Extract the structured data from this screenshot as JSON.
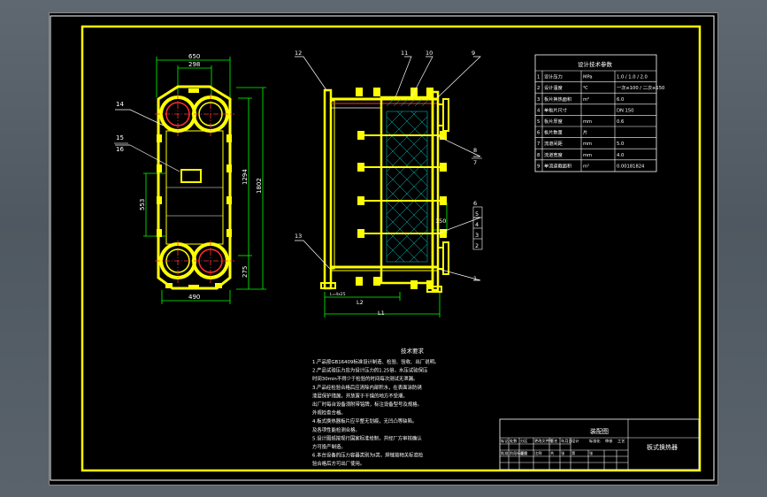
{
  "colors": {
    "background": "#000000",
    "frame": "#ffff00",
    "lines": "#ffffff",
    "dimension": "#00ff00",
    "center_line": "#ff3030",
    "leader": "#ffffff",
    "hatch": "#00d0d0",
    "app_backdrop": "#56606a"
  },
  "front_view": {
    "dim_top_outer": "650",
    "dim_top_inner": "298",
    "dim_height": "1802",
    "dim_port_center": "1294",
    "dim_middle": "553",
    "dim_bottom_offset": "275",
    "dim_bottom_width": "490",
    "label_14": "14",
    "label_15": "15",
    "label_16": "16"
  },
  "side_view": {
    "label_12": "12",
    "label_11": "11",
    "label_10": "10",
    "label_9": "9",
    "label_8": "8",
    "label_7": "7",
    "label_6": "6",
    "label_5": "5",
    "label_4": "4",
    "label_3": "3",
    "label_2": "2",
    "label_1": "1",
    "label_13": "13",
    "dim_150": "150",
    "dim_L2": "L2",
    "dim_L1": "L1",
    "small_note": "L=4x25"
  },
  "tech_table": {
    "title": "设计技术参数",
    "rows": [
      {
        "no": "1",
        "name": "设计压力",
        "unit": "MPa",
        "value": "1.0 / 1.0 / 2.0"
      },
      {
        "no": "2",
        "name": "设计温度",
        "unit": "℃",
        "value": "一次≤100 / 二次≤150"
      },
      {
        "no": "3",
        "name": "板片换热面积",
        "unit": "m²",
        "value": "6.0"
      },
      {
        "no": "4",
        "name": "单板片尺寸",
        "unit": "",
        "value": "DN 150"
      },
      {
        "no": "5",
        "name": "板片厚度",
        "unit": "mm",
        "value": "0.6"
      },
      {
        "no": "6",
        "name": "板片数量",
        "unit": "片",
        "value": ""
      },
      {
        "no": "7",
        "name": "流道间距",
        "unit": "mm",
        "value": "5.0"
      },
      {
        "no": "8",
        "name": "流道宽度",
        "unit": "mm",
        "value": "4.0"
      },
      {
        "no": "9",
        "name": "单流道截面积",
        "unit": "m²",
        "value": "0.00181824"
      }
    ]
  },
  "tech_requirements": {
    "title": "技术要求",
    "lines": [
      "1.产品按GB16409标准设计制造、检验、验收、出厂说明。",
      "2.产品试验压力应为设计压力的1.25倍，水压试验保压",
      "  时间30min不得少于检验的时间每次测试无泄漏。",
      "3.产品经检验合格后应清除内部积水，在表面涂防锈",
      "  漆层保护措施，并放置于干燥的地方不受潮。",
      "  出厂时每台设备须附带铭牌，标注设备型号及规格。",
      "  外观检查合格。",
      "4.板式换热器板片应平整无划痕，无凹凸等缺陷。",
      "  及各项性能检测合格。",
      "5.设计图纸按现行国家标准绘制，并经厂方审核确认",
      "  方可投产制造。",
      "6.本台设备的压力容器类别为I类，焊缝按相关标准检",
      "  验合格后方可出厂使用。"
    ]
  },
  "title_block": {
    "drawing_title": "板式换热器",
    "scale_label": "装配图",
    "cells": [
      "标记",
      "处数",
      "分区",
      "更改文件号",
      "签名",
      "年月日",
      "设计",
      "标准化",
      "审核",
      "工艺",
      "批准",
      "阶段标记",
      "重量",
      "比例",
      "共",
      "张",
      "第",
      "张"
    ]
  }
}
